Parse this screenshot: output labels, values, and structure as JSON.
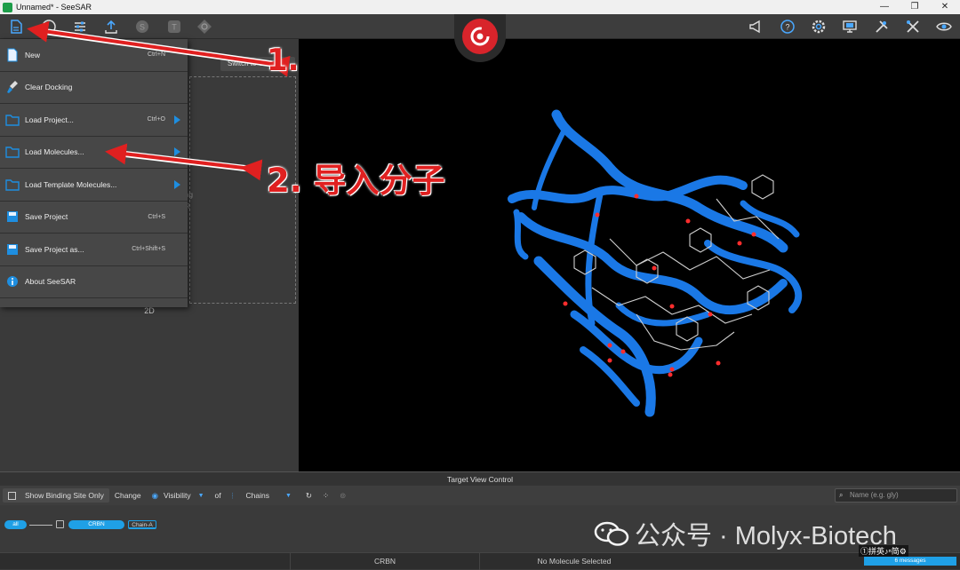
{
  "window": {
    "title": "Unnamed* - SeeSAR",
    "controls": [
      "—",
      "❐",
      "✕"
    ]
  },
  "toolbar": {
    "icons": [
      "file-menu-icon",
      "globe-icon",
      "sliders-icon",
      "upload-icon",
      "s-mode-icon",
      "t-mode-icon",
      "o-mode-icon"
    ],
    "right_icons": [
      "megaphone-icon",
      "help-icon",
      "settings-icon",
      "monitor-icon",
      "tools-icon",
      "crossed-tools-icon",
      "eye-icon"
    ]
  },
  "panel2d": {
    "switch_label": "Switch to Grid",
    "label": "2D",
    "ghost1": "ag",
    "ghost2": "R"
  },
  "menu": {
    "items": [
      {
        "label": "New",
        "shortcut": "Ctrl+N",
        "arrow": false
      },
      {
        "label": "Clear Docking",
        "shortcut": "",
        "arrow": false
      },
      {
        "label": "Load Project...",
        "shortcut": "Ctrl+O",
        "arrow": true
      },
      {
        "label": "Load Molecules...",
        "shortcut": "",
        "arrow": true
      },
      {
        "label": "Load Template Molecules...",
        "shortcut": "",
        "arrow": true
      },
      {
        "label": "Save Project",
        "shortcut": "Ctrl+S",
        "arrow": false
      },
      {
        "label": "Save Project as...",
        "shortcut": "Ctrl+Shift+S",
        "arrow": false
      },
      {
        "label": "About SeeSAR",
        "shortcut": "",
        "arrow": false
      }
    ]
  },
  "annotations": {
    "step1": "1.",
    "step2": "2. 导入分子"
  },
  "target_view": {
    "title": "Target View Control",
    "show_binding": "Show Binding Site Only",
    "change": "Change",
    "visibility": "Visibility",
    "of": "of",
    "chains": "Chains",
    "search_placeholder": "Name (e.g. gly)"
  },
  "tree": {
    "all": "all",
    "crbn": "CRBN",
    "chain": "Chain-A"
  },
  "status": {
    "target": "CRBN",
    "molecule": "No Molecule Selected",
    "messages": "6 messages"
  },
  "watermark": {
    "text": "公众号 · Molyx-Biotech"
  },
  "ime": "①拼英♪ⁿ简⚙"
}
